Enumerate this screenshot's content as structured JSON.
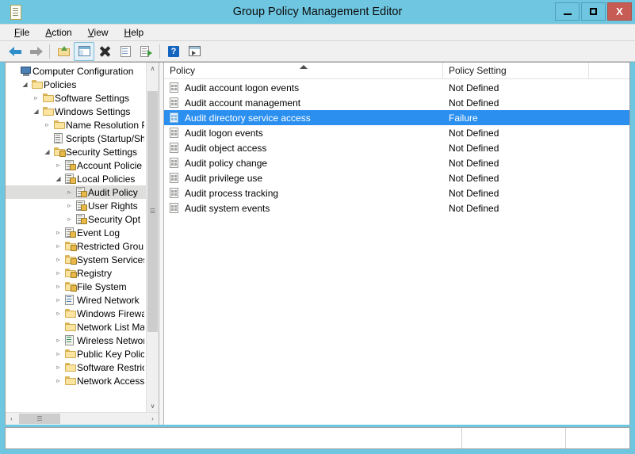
{
  "window": {
    "title": "Group Policy Management Editor",
    "icon": "document-icon",
    "buttons": {
      "minimize": "–",
      "maximize": "□",
      "close": "X"
    },
    "title_bar_color": "#6ec6e0",
    "close_button_color": "#c75c54"
  },
  "menubar": {
    "items": [
      {
        "label": "File",
        "accel": "F"
      },
      {
        "label": "Action",
        "accel": "A"
      },
      {
        "label": "View",
        "accel": "V"
      },
      {
        "label": "Help",
        "accel": "H"
      }
    ]
  },
  "toolbar": {
    "items": [
      {
        "name": "back-arrow-icon",
        "tip": "Back"
      },
      {
        "name": "forward-arrow-icon",
        "tip": "Forward"
      },
      {
        "name": "up-one-level-icon",
        "tip": "Up One Level"
      },
      {
        "name": "show-hide-tree-icon",
        "tip": "Show/Hide Console Tree",
        "selected": true
      },
      {
        "name": "delete-icon",
        "tip": "Delete"
      },
      {
        "name": "properties-icon",
        "tip": "Properties"
      },
      {
        "name": "export-list-icon",
        "tip": "Export List"
      },
      {
        "name": "help-icon",
        "tip": "Help"
      },
      {
        "name": "show-action-pane-icon",
        "tip": "Show/Hide Action Pane"
      }
    ]
  },
  "tree": {
    "items": [
      {
        "label": "Computer Configuration",
        "indent": 0,
        "twisty": "",
        "icon": "computer-icon",
        "selected": false
      },
      {
        "label": "Policies",
        "indent": 1,
        "twisty": "◢",
        "icon": "folder-icon",
        "selected": false
      },
      {
        "label": "Software Settings",
        "indent": 2,
        "twisty": "▹",
        "icon": "folder-icon",
        "selected": false
      },
      {
        "label": "Windows Settings",
        "indent": 2,
        "twisty": "◢",
        "icon": "folder-icon",
        "selected": false
      },
      {
        "label": "Name Resolution P",
        "indent": 3,
        "twisty": "▹",
        "icon": "folder-icon",
        "selected": false
      },
      {
        "label": "Scripts (Startup/Shu",
        "indent": 3,
        "twisty": "",
        "icon": "script-icon",
        "selected": false
      },
      {
        "label": "Security Settings",
        "indent": 3,
        "twisty": "◢",
        "icon": "folder-lock-icon",
        "selected": false
      },
      {
        "label": "Account Policie",
        "indent": 4,
        "twisty": "▹",
        "icon": "policy-node-icon",
        "selected": false
      },
      {
        "label": "Local Policies",
        "indent": 4,
        "twisty": "◢",
        "icon": "policy-node-icon",
        "selected": false
      },
      {
        "label": "Audit Policy",
        "indent": 5,
        "twisty": "▹",
        "icon": "policy-node-icon",
        "selected": true
      },
      {
        "label": "User Rights ",
        "indent": 5,
        "twisty": "▹",
        "icon": "policy-node-icon",
        "selected": false
      },
      {
        "label": "Security Opt",
        "indent": 5,
        "twisty": "▹",
        "icon": "policy-node-icon",
        "selected": false
      },
      {
        "label": "Event Log",
        "indent": 4,
        "twisty": "▹",
        "icon": "policy-node-icon",
        "selected": false
      },
      {
        "label": "Restricted Grou",
        "indent": 4,
        "twisty": "▹",
        "icon": "folder-lock-icon",
        "selected": false
      },
      {
        "label": "System Services",
        "indent": 4,
        "twisty": "▹",
        "icon": "folder-lock-icon",
        "selected": false
      },
      {
        "label": "Registry",
        "indent": 4,
        "twisty": "▹",
        "icon": "folder-lock-icon",
        "selected": false
      },
      {
        "label": "File System",
        "indent": 4,
        "twisty": "▹",
        "icon": "folder-lock-icon",
        "selected": false
      },
      {
        "label": "Wired Network",
        "indent": 4,
        "twisty": "▹",
        "icon": "wired-network-icon",
        "selected": false
      },
      {
        "label": "Windows Firewa",
        "indent": 4,
        "twisty": "▹",
        "icon": "folder-icon",
        "selected": false
      },
      {
        "label": "Network List Ma",
        "indent": 4,
        "twisty": "",
        "icon": "folder-icon",
        "selected": false
      },
      {
        "label": "Wireless Networ",
        "indent": 4,
        "twisty": "▹",
        "icon": "wireless-network-icon",
        "selected": false
      },
      {
        "label": "Public Key Polic",
        "indent": 4,
        "twisty": "▹",
        "icon": "folder-icon",
        "selected": false
      },
      {
        "label": "Software Restric",
        "indent": 4,
        "twisty": "▹",
        "icon": "folder-icon",
        "selected": false
      },
      {
        "label": "Network Access",
        "indent": 4,
        "twisty": "▹",
        "icon": "folder-icon",
        "selected": false
      }
    ],
    "scroll": {
      "up_arrow": "∧",
      "down_arrow": "∨",
      "left_arrow": "‹",
      "right_arrow": "›",
      "grip": "‖"
    }
  },
  "list": {
    "columns": [
      {
        "label": "Policy",
        "sorted": "asc"
      },
      {
        "label": "Policy Setting",
        "sorted": ""
      },
      {
        "label": "",
        "sorted": ""
      }
    ],
    "rows": [
      {
        "policy": "Audit account logon events",
        "setting": "Not Defined",
        "selected": false
      },
      {
        "policy": "Audit account management",
        "setting": "Not Defined",
        "selected": false
      },
      {
        "policy": "Audit directory service access",
        "setting": "Failure",
        "selected": true
      },
      {
        "policy": "Audit logon events",
        "setting": "Not Defined",
        "selected": false
      },
      {
        "policy": "Audit object access",
        "setting": "Not Defined",
        "selected": false
      },
      {
        "policy": "Audit policy change",
        "setting": "Not Defined",
        "selected": false
      },
      {
        "policy": "Audit privilege use",
        "setting": "Not Defined",
        "selected": false
      },
      {
        "policy": "Audit process tracking",
        "setting": "Not Defined",
        "selected": false
      },
      {
        "policy": "Audit system events",
        "setting": "Not Defined",
        "selected": false
      }
    ],
    "selection_color": "#2a8fef",
    "row_icon": "policy-setting-icon"
  },
  "statusbar": {
    "panes": [
      "",
      "",
      ""
    ]
  }
}
